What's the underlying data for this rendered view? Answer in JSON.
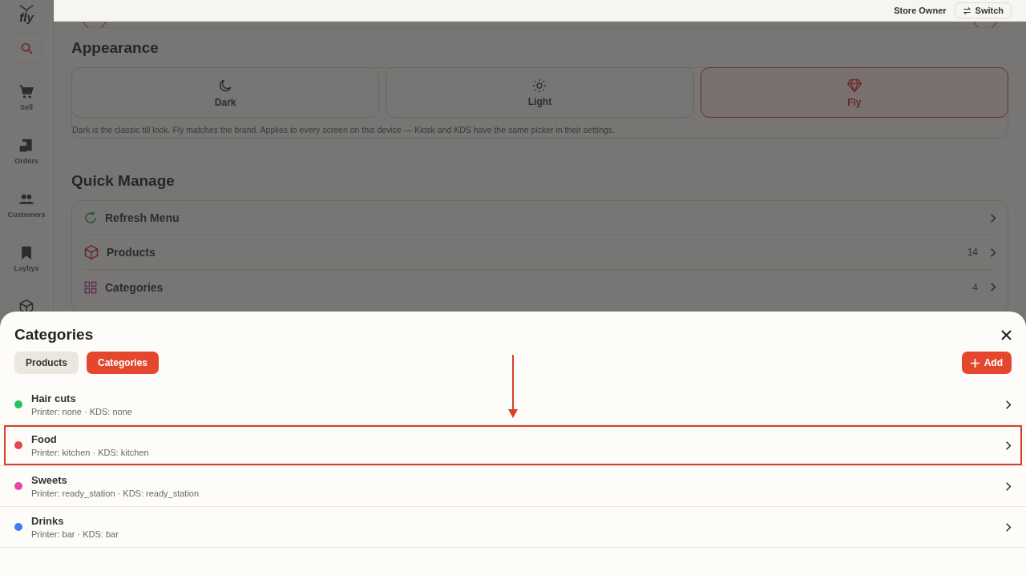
{
  "sidebar": {
    "logo": "fly",
    "items": [
      {
        "label": "Sell"
      },
      {
        "label": "Orders"
      },
      {
        "label": "Customers"
      },
      {
        "label": "Laybys"
      }
    ]
  },
  "top_bar": {
    "role": "Store Owner",
    "switch_button": "Switch"
  },
  "appearance": {
    "title": "Appearance",
    "options": [
      {
        "label": "Dark",
        "selected": false
      },
      {
        "label": "Light",
        "selected": false
      },
      {
        "label": "Fly",
        "selected": true
      }
    ],
    "note": "Dark is the classic till look. Fly matches the brand. Applies to every screen on this device — Kiosk and KDS have the same picker in their settings."
  },
  "quick_manage": {
    "title": "Quick Manage",
    "items": [
      {
        "label": "Refresh Menu"
      },
      {
        "label": "Products",
        "count": "14"
      },
      {
        "label": "Categories",
        "count": "4"
      }
    ]
  },
  "sheet": {
    "title": "Categories",
    "tabs": [
      {
        "label": "Products",
        "selected": false
      },
      {
        "label": "Categories",
        "selected": true
      }
    ],
    "add_button": "Add",
    "rows": [
      {
        "name": "Hair cuts",
        "details": "Printer: none · KDS: none",
        "color": "#22c55e",
        "highlighted": false
      },
      {
        "name": "Food",
        "details": "Printer: kitchen · KDS: kitchen",
        "color": "#e5484d",
        "highlighted": true
      },
      {
        "name": "Sweets",
        "details": "Printer: ready_station · KDS: ready_station",
        "color": "#e548a0",
        "highlighted": false
      },
      {
        "name": "Drinks",
        "details": "Printer: bar · KDS: bar",
        "color": "#3b7ff0",
        "highlighted": false
      }
    ]
  }
}
